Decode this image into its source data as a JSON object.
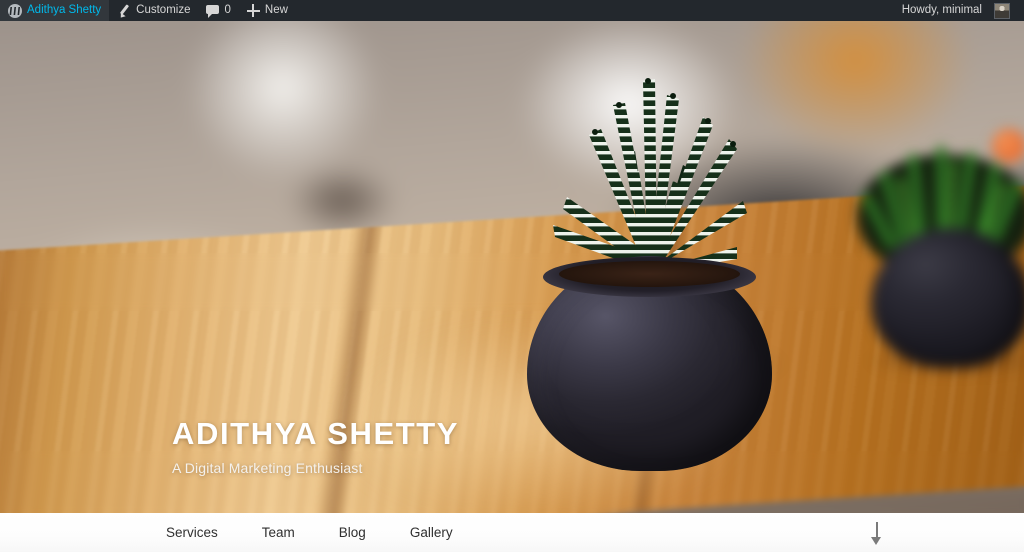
{
  "admin_bar": {
    "wp_logo_icon": "wordpress-logo-icon",
    "site_name": "Adithya Shetty",
    "customize": {
      "label": "Customize",
      "icon": "pencil-icon"
    },
    "comments": {
      "count": "0",
      "icon": "comment-bubble-icon"
    },
    "new": {
      "label": "New",
      "icon": "plus-icon"
    },
    "howdy": "Howdy, minimal",
    "avatar_icon": "user-avatar-icon"
  },
  "hero": {
    "title": "ADITHYA SHETTY",
    "subtitle": "A Digital Marketing Enthusiast",
    "background_description": "Zebra haworthia succulent in a dark charcoal round pot on a sunlit wooden table, blurred interior behind",
    "colors": {
      "wood_light": "#f0cb92",
      "wood_mid": "#d19a4e",
      "wood_dark": "#9c5c14",
      "pot": "#2a2832",
      "wall_orange": "#d68e38"
    }
  },
  "nav": {
    "items": [
      {
        "label": "Services"
      },
      {
        "label": "Team"
      },
      {
        "label": "Blog"
      },
      {
        "label": "Gallery"
      }
    ],
    "scroll_down_icon": "arrow-down-icon"
  }
}
